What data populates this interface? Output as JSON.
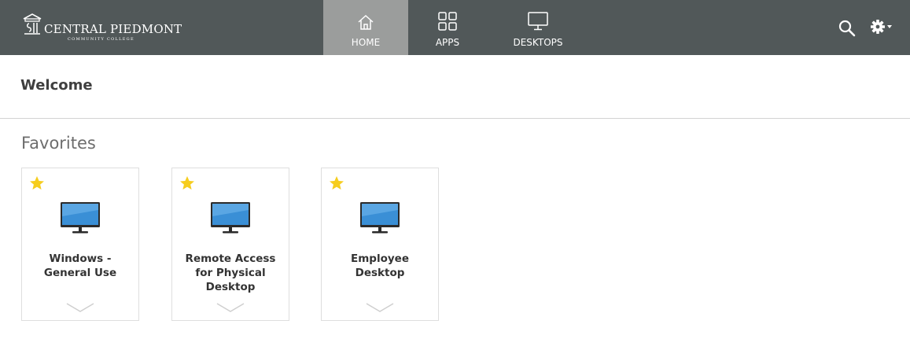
{
  "header": {
    "brand_name": "CENTRAL PIEDMONT",
    "brand_sub": "COMMUNITY COLLEGE",
    "nav": [
      {
        "label": "HOME",
        "icon": "home-icon",
        "active": true
      },
      {
        "label": "APPS",
        "icon": "apps-grid-icon",
        "active": false
      },
      {
        "label": "DESKTOPS",
        "icon": "desktop-monitor-icon",
        "active": false
      }
    ],
    "actions": [
      "search-icon",
      "gear-icon"
    ]
  },
  "main": {
    "title": "Welcome",
    "section_title": "Favorites",
    "favorites": [
      {
        "name": "Windows - General Use",
        "icon": "desktop-monitor-icon",
        "favorite": true
      },
      {
        "name": "Remote Access for Physical Desktop",
        "icon": "desktop-monitor-icon",
        "favorite": true
      },
      {
        "name": "Employee Desktop",
        "icon": "desktop-monitor-icon",
        "favorite": true
      }
    ]
  },
  "colors": {
    "header_bg": "#515859",
    "active_tab_bg": "#9b9d9c",
    "star": "#f6cd1d",
    "screen": "#3a8fd6"
  }
}
